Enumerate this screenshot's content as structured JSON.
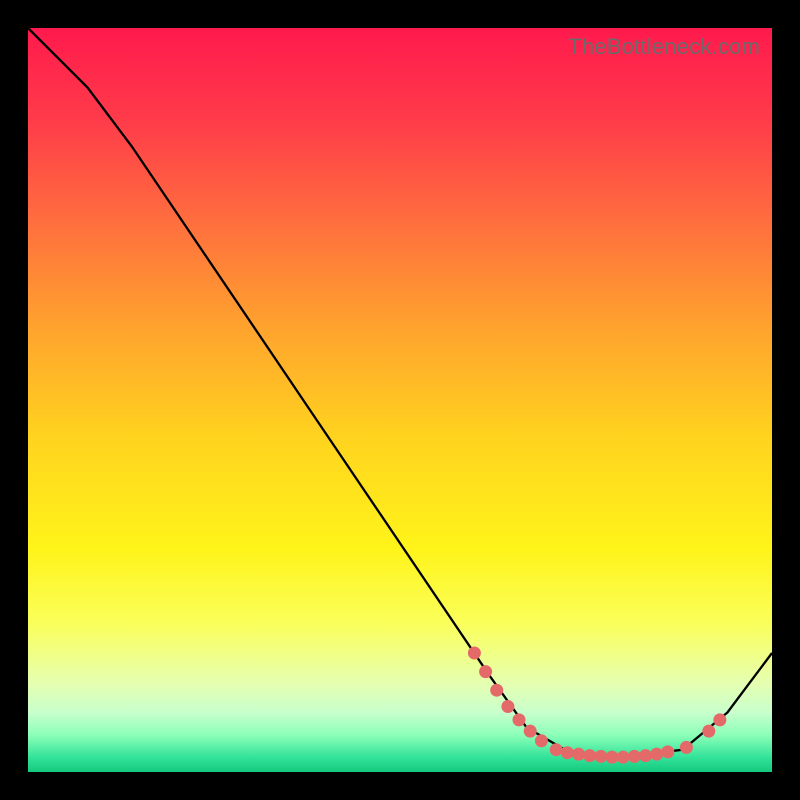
{
  "attribution": "TheBottleneck.com",
  "chart_data": {
    "type": "line",
    "title": "",
    "xlabel": "",
    "ylabel": "",
    "xlim": [
      0,
      100
    ],
    "ylim": [
      0,
      100
    ],
    "grid": false,
    "series": [
      {
        "name": "curve",
        "points": [
          {
            "x": 0,
            "y": 100
          },
          {
            "x": 8,
            "y": 92
          },
          {
            "x": 14,
            "y": 84
          },
          {
            "x": 62,
            "y": 13
          },
          {
            "x": 67,
            "y": 6
          },
          {
            "x": 73,
            "y": 2.5
          },
          {
            "x": 80,
            "y": 2
          },
          {
            "x": 88,
            "y": 3
          },
          {
            "x": 94,
            "y": 8
          },
          {
            "x": 100,
            "y": 16
          }
        ]
      }
    ],
    "markers": [
      {
        "x": 60.0,
        "y": 16.0
      },
      {
        "x": 61.5,
        "y": 13.5
      },
      {
        "x": 63.0,
        "y": 11.0
      },
      {
        "x": 64.5,
        "y": 8.8
      },
      {
        "x": 66.0,
        "y": 7.0
      },
      {
        "x": 67.5,
        "y": 5.5
      },
      {
        "x": 69.0,
        "y": 4.2
      },
      {
        "x": 71.0,
        "y": 3.0
      },
      {
        "x": 72.5,
        "y": 2.6
      },
      {
        "x": 74.0,
        "y": 2.4
      },
      {
        "x": 75.5,
        "y": 2.2
      },
      {
        "x": 77.0,
        "y": 2.1
      },
      {
        "x": 78.5,
        "y": 2.0
      },
      {
        "x": 80.0,
        "y": 2.0
      },
      {
        "x": 81.5,
        "y": 2.1
      },
      {
        "x": 83.0,
        "y": 2.2
      },
      {
        "x": 84.5,
        "y": 2.4
      },
      {
        "x": 86.0,
        "y": 2.7
      },
      {
        "x": 88.5,
        "y": 3.3
      },
      {
        "x": 91.5,
        "y": 5.5
      },
      {
        "x": 93.0,
        "y": 7.0
      }
    ]
  }
}
